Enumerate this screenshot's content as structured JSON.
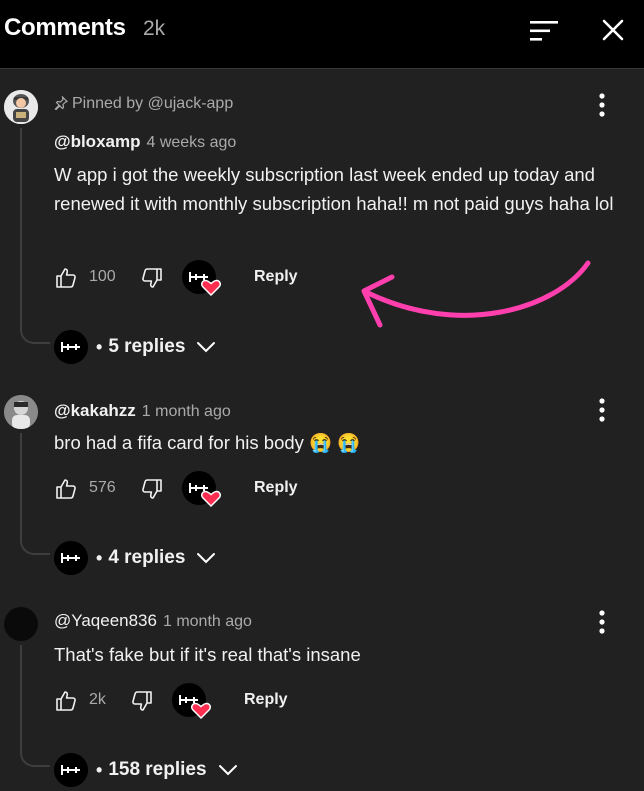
{
  "header": {
    "title": "Comments",
    "count": "2k"
  },
  "comments": [
    {
      "pinned": "Pinned by @ujack-app",
      "author": "@bloxamp",
      "time": "4 weeks ago",
      "text": "W app i got the weekly subscription last week ended up today and renewed it with monthly subscription haha!! m not paid guys haha lol",
      "likes": "100",
      "reply_label": "Reply",
      "replies_label": "5 replies"
    },
    {
      "author": "@kakahzz",
      "time": "1 month ago",
      "text": "bro had a fifa card for his body 😭 😭",
      "likes": "576",
      "reply_label": "Reply",
      "replies_label": "4 replies"
    },
    {
      "author": "@Yaqeen836",
      "time": "1 month ago",
      "text": "That's fake but if it's real that's insane",
      "likes": "2k",
      "reply_label": "Reply",
      "replies_label": "158 replies"
    }
  ],
  "icons": {
    "sort": "sort-icon",
    "close": "close-icon",
    "pin": "pin-icon",
    "more": "more-vert-icon",
    "like": "thumb-up-icon",
    "dislike": "thumb-down-icon",
    "heart": "heart-icon",
    "chevron": "chevron-down-icon"
  },
  "colors": {
    "heart": "#ff2e50",
    "arrow": "#ff3fae",
    "background": "#212121",
    "header": "#000000"
  }
}
